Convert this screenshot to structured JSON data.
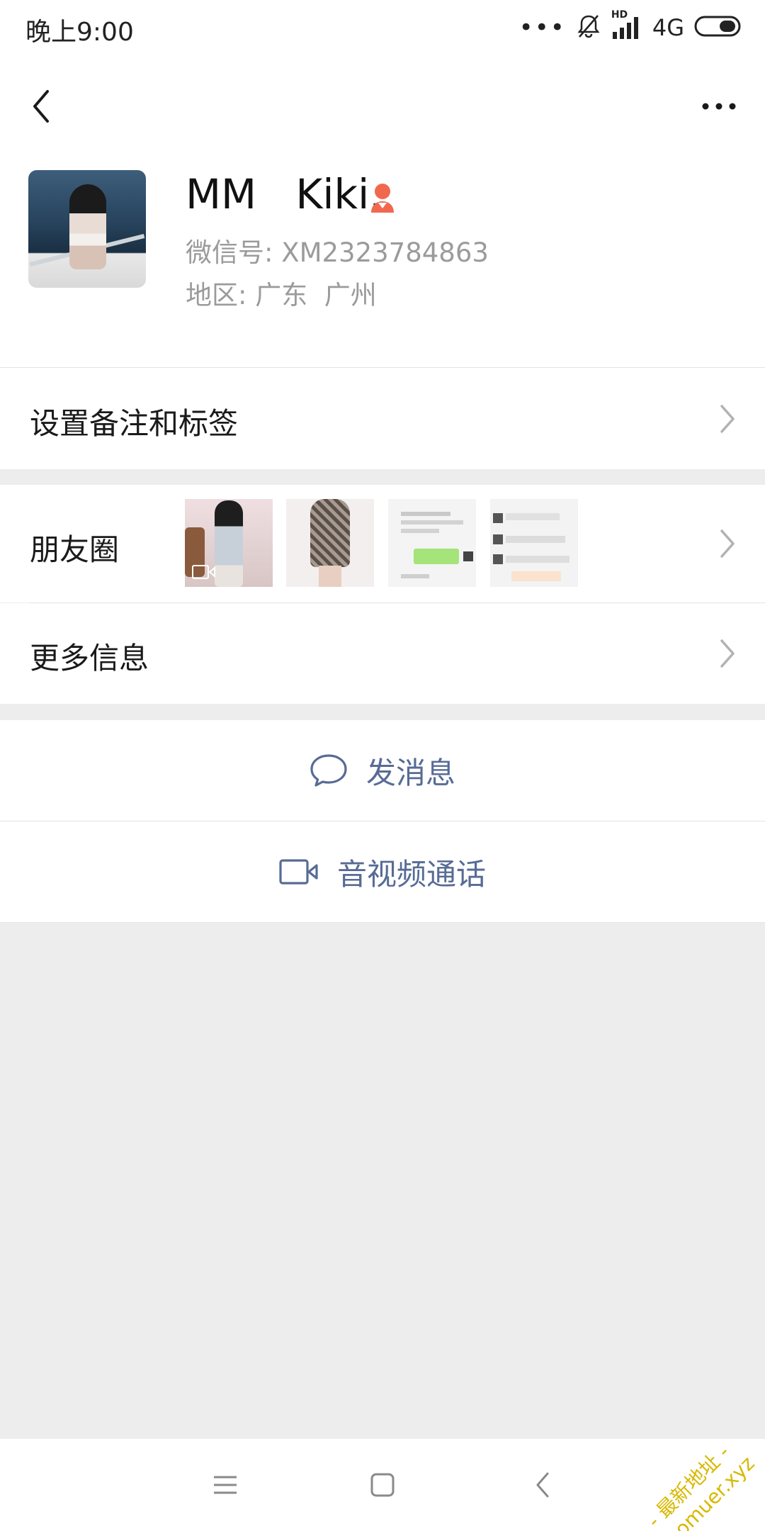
{
  "status_bar": {
    "time": "晚上9:00",
    "dots": "•••",
    "network": "4G",
    "hd": "HD"
  },
  "header": {
    "back_icon": "chevron-left-icon",
    "more_icon": "more-horizontal-icon"
  },
  "profile": {
    "nickname": "MM   Kiki.",
    "gender_icon": "female-icon",
    "wechat_id": "微信号: XM2323784863",
    "region": "地区: 广东  广州",
    "gender_color": "#fa5151"
  },
  "cells": {
    "remark": {
      "label": "设置备注和标签"
    },
    "moments": {
      "label": "朋友圈"
    },
    "more_info": {
      "label": "更多信息"
    }
  },
  "actions": {
    "message": {
      "label": "发消息",
      "icon": "chat-bubble-icon"
    },
    "call": {
      "label": "音视频通话",
      "icon": "video-camera-icon"
    }
  },
  "nav": {
    "menu_icon": "menu-icon",
    "home_icon": "home-square-icon",
    "back_icon": "back-icon"
  },
  "watermark": {
    "line1": "- 最新地址 -",
    "line2": "caomuer.xyz"
  },
  "colors": {
    "link": "#576b95",
    "background": "#ededed",
    "surface": "#ffffff",
    "secondary_text": "#9b9b9b"
  }
}
